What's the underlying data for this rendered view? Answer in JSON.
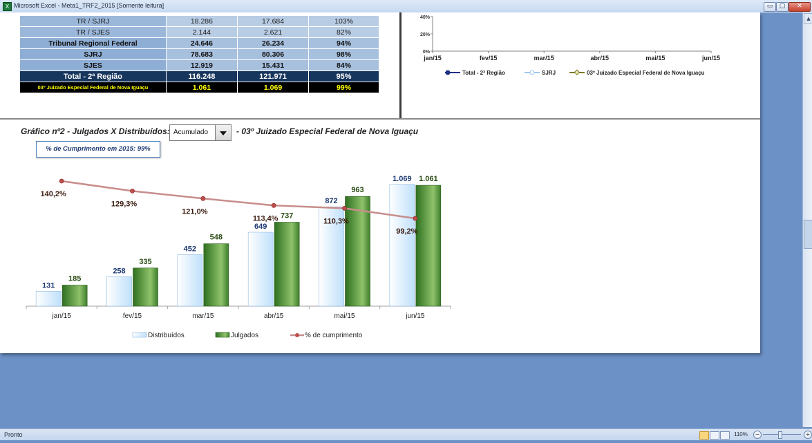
{
  "window": {
    "title": "Microsoft Excel - Meta1_TRF2_2015  [Somente leitura]",
    "app_icon": "excel-icon",
    "buttons": {
      "minimize": "▭",
      "restore": "▢",
      "close": "✕"
    }
  },
  "summary_table": {
    "rows": [
      {
        "label": "TR / SJRJ",
        "julgados": "18.286",
        "distribuidos": "17.684",
        "pct": "103%",
        "style": "light"
      },
      {
        "label": "TR / SJES",
        "julgados": "2.144",
        "distribuidos": "2.621",
        "pct": "82%",
        "style": "light"
      },
      {
        "label": "Tribunal Regional Federal",
        "julgados": "24.646",
        "distribuidos": "26.234",
        "pct": "94%",
        "style": "bold"
      },
      {
        "label": "SJRJ",
        "julgados": "78.683",
        "distribuidos": "80.306",
        "pct": "98%",
        "style": "bold"
      },
      {
        "label": "SJES",
        "julgados": "12.919",
        "distribuidos": "15.431",
        "pct": "84%",
        "style": "bold"
      },
      {
        "label": "Total - 2ª Região",
        "julgados": "116.248",
        "distribuidos": "121.971",
        "pct": "95%",
        "style": "total"
      },
      {
        "label": "03º Juizado Especial Federal de Nova Iguaçu",
        "julgados": "1.061",
        "distribuidos": "1.069",
        "pct": "99%",
        "style": "vara"
      }
    ]
  },
  "top_chart": {
    "chart_data": {
      "type": "line",
      "categories": [
        "jan/15",
        "fev/15",
        "mar/15",
        "abr/15",
        "mai/15",
        "jun/15"
      ],
      "y_ticks": [
        "0%",
        "20%",
        "40%"
      ],
      "legend": [
        "Total - 2ª Região",
        "SJRJ",
        "03º Juizado Especial Federal de Nova Iguaçu"
      ],
      "colors": [
        "#1f2f86",
        "#9fc8ee",
        "#7d7a2a"
      ]
    }
  },
  "section2": {
    "title": "Gráfico nº2 - Julgados X Distribuídos:",
    "select_value": "Acumulado",
    "subtitle": "- 03º Juizado Especial Federal de Nova Iguaçu",
    "pct_box": "% de Cumprimento em 2015: 99%"
  },
  "chart_data": {
    "type": "bar",
    "categories": [
      "jan/15",
      "fev/15",
      "mar/15",
      "abr/15",
      "mai/15",
      "jun/15"
    ],
    "series": [
      {
        "name": "Distribuídos",
        "values": [
          131,
          258,
          452,
          649,
          872,
          1069
        ],
        "labels": [
          "131",
          "258",
          "452",
          "649",
          "872",
          "1.069"
        ],
        "color": "#bfe0fb"
      },
      {
        "name": "Julgados",
        "values": [
          185,
          335,
          548,
          737,
          963,
          1061
        ],
        "labels": [
          "185",
          "335",
          "548",
          "737",
          "963",
          "1.061"
        ],
        "color": "#3f8a2c"
      },
      {
        "name": "% de cumprimento",
        "type": "line",
        "values": [
          140.2,
          129.3,
          121.0,
          113.4,
          110.3,
          99.2
        ],
        "labels": [
          "140,2%",
          "129,3%",
          "121,0%",
          "113,4%",
          "110,3%",
          "99,2%"
        ],
        "color": "#c0504d"
      }
    ],
    "legend_position": "bottom"
  },
  "status_bar": {
    "status": "Pronto",
    "zoom": "110%",
    "zoom_minus": "−",
    "zoom_plus": "+"
  }
}
